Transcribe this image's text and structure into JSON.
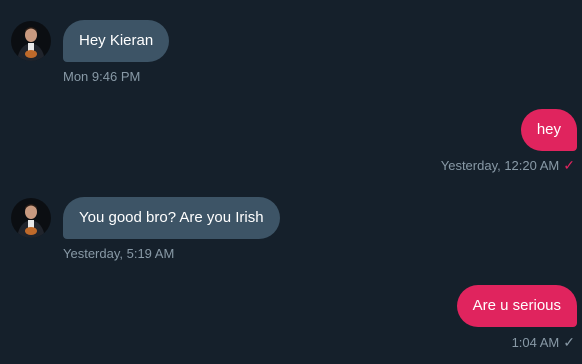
{
  "messages": [
    {
      "direction": "in",
      "text": "Hey Kieran",
      "time": "Mon 9:46 PM"
    },
    {
      "direction": "out",
      "text": "hey",
      "time": "Yesterday, 12:20 AM",
      "status_icon": "checkmark-icon",
      "status_color": "#e0245e"
    },
    {
      "direction": "in",
      "text": "You good bro? Are you Irish",
      "time": "Yesterday, 5:19 AM"
    },
    {
      "direction": "out",
      "text": "Are u serious",
      "time": "1:04 AM",
      "status_icon": "checkmark-icon",
      "status_color": "#8899a6"
    }
  ],
  "colors": {
    "background": "#15202b",
    "incoming_bubble": "#3d5466",
    "outgoing_bubble": "#e0245e",
    "meta_text": "#8899a6"
  }
}
